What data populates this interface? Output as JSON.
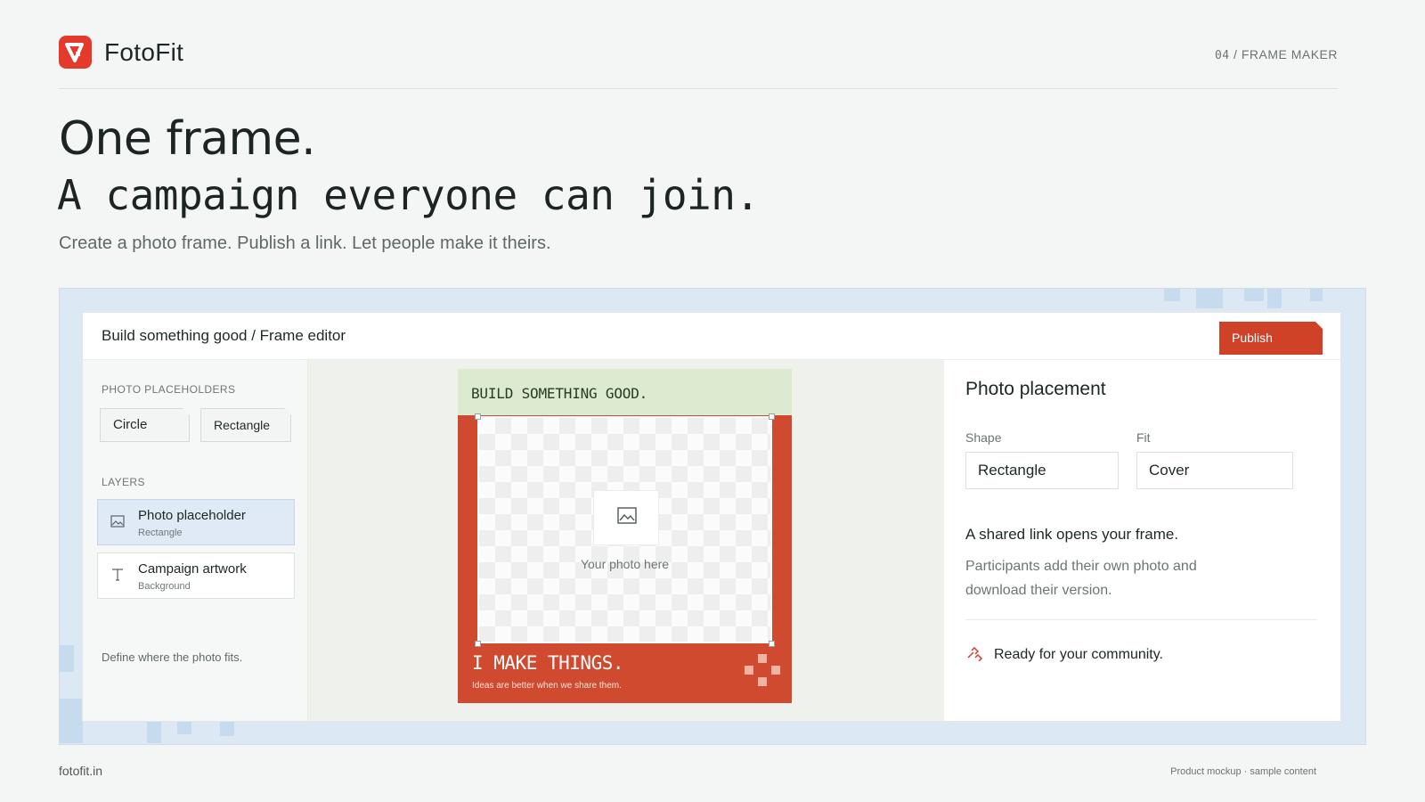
{
  "brand": {
    "name": "FotoFit",
    "accent": "#e5392c"
  },
  "top_crumb": {
    "number": "04",
    "separator": "/",
    "label": "FRAME MAKER"
  },
  "hero": {
    "title": "One frame.",
    "subtitle": "A campaign everyone can join.",
    "description": "Create a photo frame. Publish a link. Let people make it theirs."
  },
  "editor": {
    "breadcrumb": "Build something good / Frame editor",
    "publish_label": "Publish",
    "left": {
      "placeholders_label": "PHOTO PLACEHOLDERS",
      "placeholder_options": [
        "Circle",
        "Rectangle"
      ],
      "layers_label": "LAYERS",
      "layers": [
        {
          "name": "Photo placeholder",
          "sub": "Rectangle",
          "icon": "image-icon",
          "active": true
        },
        {
          "name": "Campaign artwork",
          "sub": "Background",
          "icon": "text-icon",
          "active": false
        }
      ],
      "hint": "Define where the photo fits."
    },
    "frame": {
      "top_text": "BUILD SOMETHING GOOD.",
      "placeholder_text": "Your photo here",
      "bottom_title": "I MAKE THINGS.",
      "bottom_sub": "Ideas are better when we share them.",
      "colors": {
        "frame": "#cf4a2e",
        "band": "#dceacf"
      }
    },
    "right": {
      "title": "Photo placement",
      "shape_label": "Shape",
      "shape_value": "Rectangle",
      "fit_label": "Fit",
      "fit_value": "Cover",
      "note": "A shared link opens your frame.",
      "description": "Participants add their own photo and download their version.",
      "ready": "Ready for your community."
    }
  },
  "footer": {
    "site": "fotofit.in",
    "note": "Product mockup · sample content"
  }
}
